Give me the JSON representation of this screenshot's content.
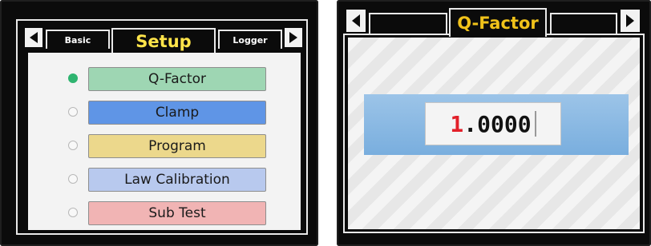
{
  "setup_screen": {
    "title": "Setup",
    "left_tab": "Basic",
    "right_tab": "Logger",
    "menu_items": [
      {
        "label": "Q-Factor",
        "color": "#9ed6b3",
        "selected": true
      },
      {
        "label": "Clamp",
        "color": "#5f95e6",
        "selected": false
      },
      {
        "label": "Program",
        "color": "#ecd88c",
        "selected": false
      },
      {
        "label": "Law Calibration",
        "color": "#b8c9ee",
        "selected": false
      },
      {
        "label": "Sub Test",
        "color": "#f1b4b4",
        "selected": false
      }
    ]
  },
  "qfactor_screen": {
    "title": "Q-Factor",
    "value_active_digit": "1",
    "value_rest": ".0000"
  },
  "colors": {
    "title_text": "#ffe44a",
    "title_text_right": "#f0c21a",
    "active_digit": "#e2202a",
    "radio_on": "#2fb470",
    "value_bar": "#79aede"
  }
}
